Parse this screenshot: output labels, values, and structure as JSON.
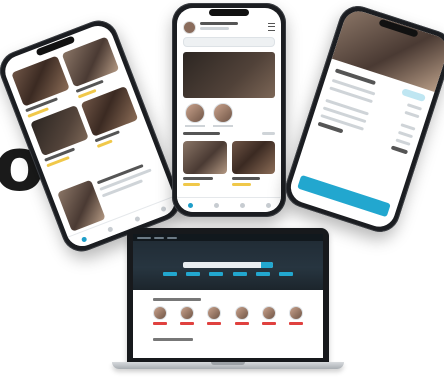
{
  "headline_fragment": "or",
  "colors": {
    "accent": "#22a7cf",
    "badge": "#e0413f",
    "highlight": "#f0c84a",
    "device_frame": "#1b1d21"
  },
  "icons": [
    "menu-icon"
  ]
}
